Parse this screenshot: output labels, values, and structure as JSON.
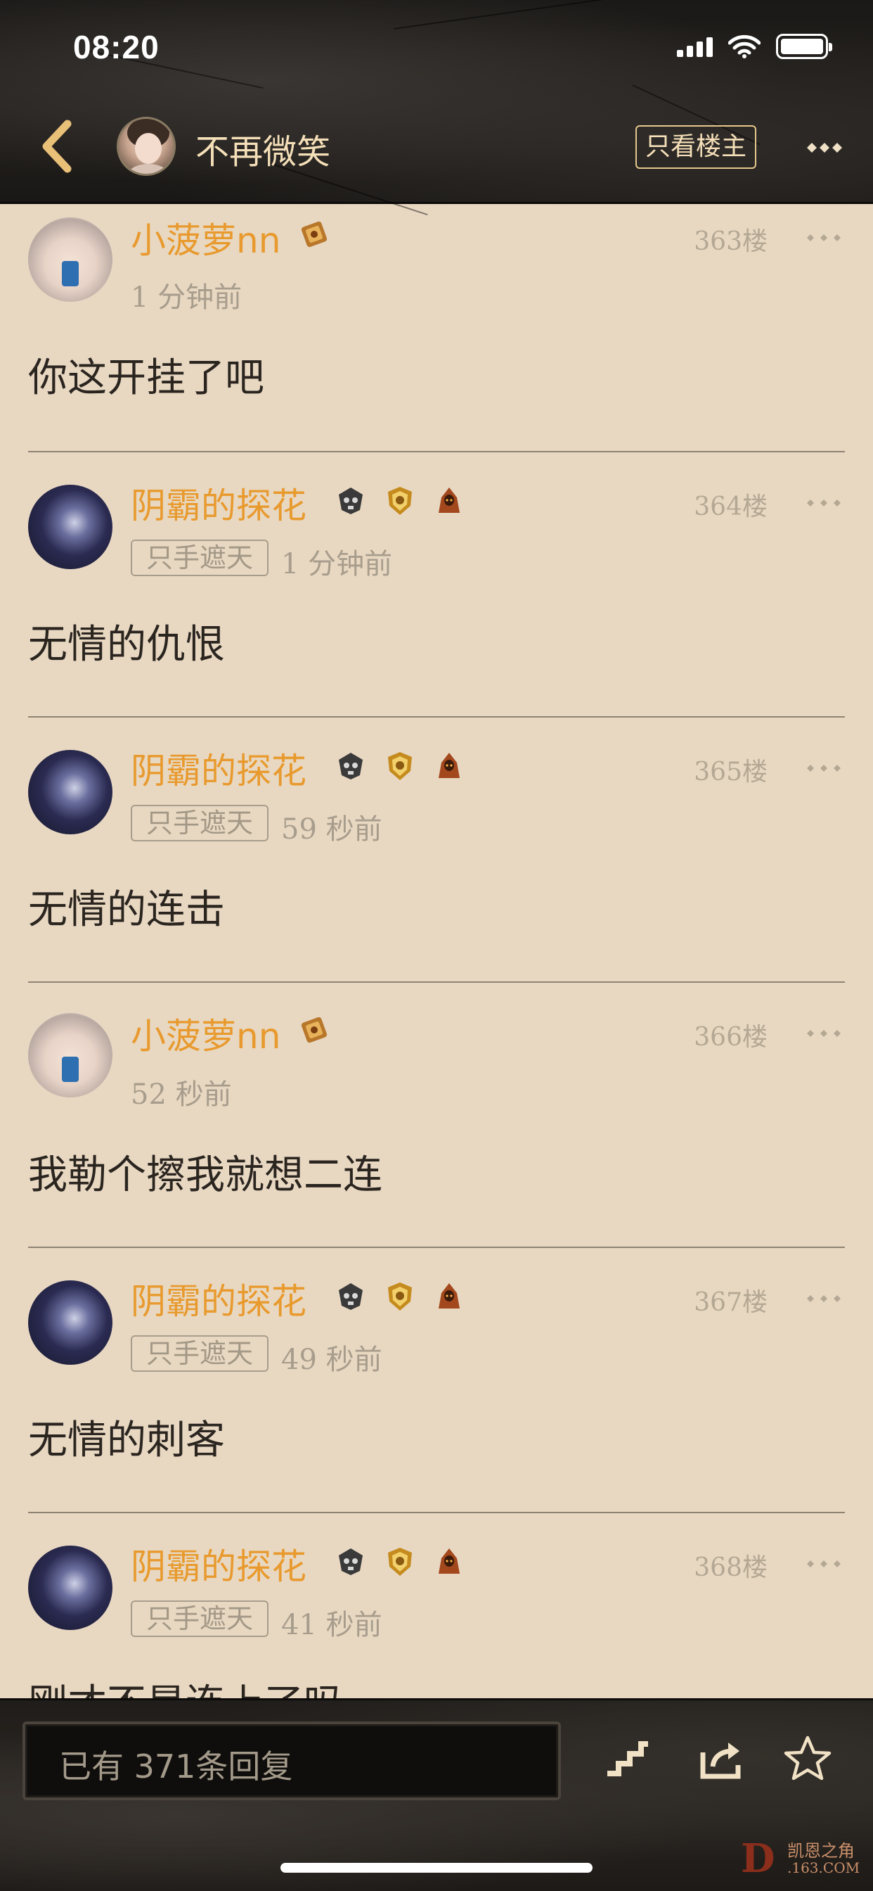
{
  "status_bar": {
    "time": "08:20"
  },
  "nav": {
    "title": "不再微笑",
    "only_host_label": "只看楼主"
  },
  "posts": [
    {
      "username": "小菠萝nn",
      "floor": "363楼",
      "tag": "",
      "time": "1 分钟前",
      "content": "你这开挂了吧"
    },
    {
      "username": "阴霸的探花",
      "floor": "364楼",
      "tag": "只手遮天",
      "time": "1 分钟前",
      "content": "无情的仇恨"
    },
    {
      "username": "阴霸的探花",
      "floor": "365楼",
      "tag": "只手遮天",
      "time": "59 秒前",
      "content": "无情的连击"
    },
    {
      "username": "小菠萝nn",
      "floor": "366楼",
      "tag": "",
      "time": "52 秒前",
      "content": "我勒个擦我就想二连"
    },
    {
      "username": "阴霸的探花",
      "floor": "367楼",
      "tag": "只手遮天",
      "time": "49 秒前",
      "content": "无情的刺客"
    },
    {
      "username": "阴霸的探花",
      "floor": "368楼",
      "tag": "只手遮天",
      "time": "41 秒前",
      "content": "刚才不是连上了吗"
    }
  ],
  "bottom_bar": {
    "reply_placeholder": "已有 371条回复"
  },
  "watermark": {
    "letter": "D",
    "name": "凯恩之角",
    "domain": ".163.COM"
  },
  "colors": {
    "accent": "#e89a2e",
    "header_bg": "#1f1c19",
    "page_bg": "#e8d8c2"
  }
}
